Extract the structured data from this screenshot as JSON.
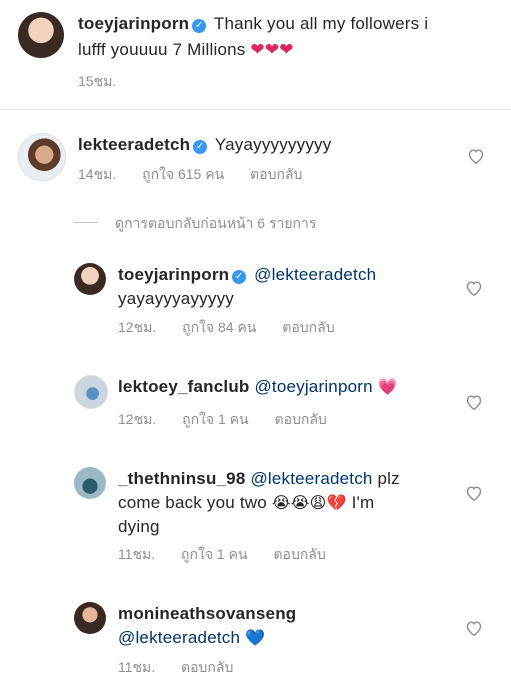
{
  "caption": {
    "username": "toeyjarinporn",
    "text_line1": "Thank you all my followers i",
    "text_line2": "lufff youuuu 7 Millions",
    "hearts": "❤❤❤",
    "time": "15ชม."
  },
  "comments": [
    {
      "username": "lekteeradetch",
      "text": "Yayayyyyyyyyy",
      "time": "14ชม.",
      "likes": "ถูกใจ 615 คน",
      "reply": "ตอบกลับ"
    }
  ],
  "view_previous": "ดูการตอบกลับก่อนหน้า 6 รายการ",
  "replies": [
    {
      "username": "toeyjarinporn",
      "mention": "@lekteeradetch",
      "text": "yayayyyayyyyy",
      "time": "12ชม.",
      "likes": "ถูกใจ 84 คน",
      "reply": "ตอบกลับ"
    },
    {
      "username": "lektoey_fanclub",
      "mention": "@toeyjarinporn",
      "emoji": "💗",
      "time": "12ชม.",
      "likes": "ถูกใจ 1 คน",
      "reply": "ตอบกลับ"
    },
    {
      "username": "_thethninsu_98",
      "mention": "@lekteeradetch",
      "text_a": "plz",
      "text_b": "come back you two",
      "emojis": "😭😭😩💔",
      "text_c": "I'm",
      "text_d": "dying",
      "time": "11ชม.",
      "likes": "ถูกใจ 1 คน",
      "reply": "ตอบกลับ"
    },
    {
      "username": "monineathsovanseng",
      "mention": "@lekteeradetch",
      "emoji": "💙",
      "time": "11ชม.",
      "reply": "ตอบกลับ"
    }
  ],
  "icons": {
    "verified": "verified-badge-icon",
    "like": "heart-outline-icon"
  },
  "colors": {
    "verified": "#3897f0",
    "mention": "#003569",
    "meta": "#8e8e8e"
  }
}
